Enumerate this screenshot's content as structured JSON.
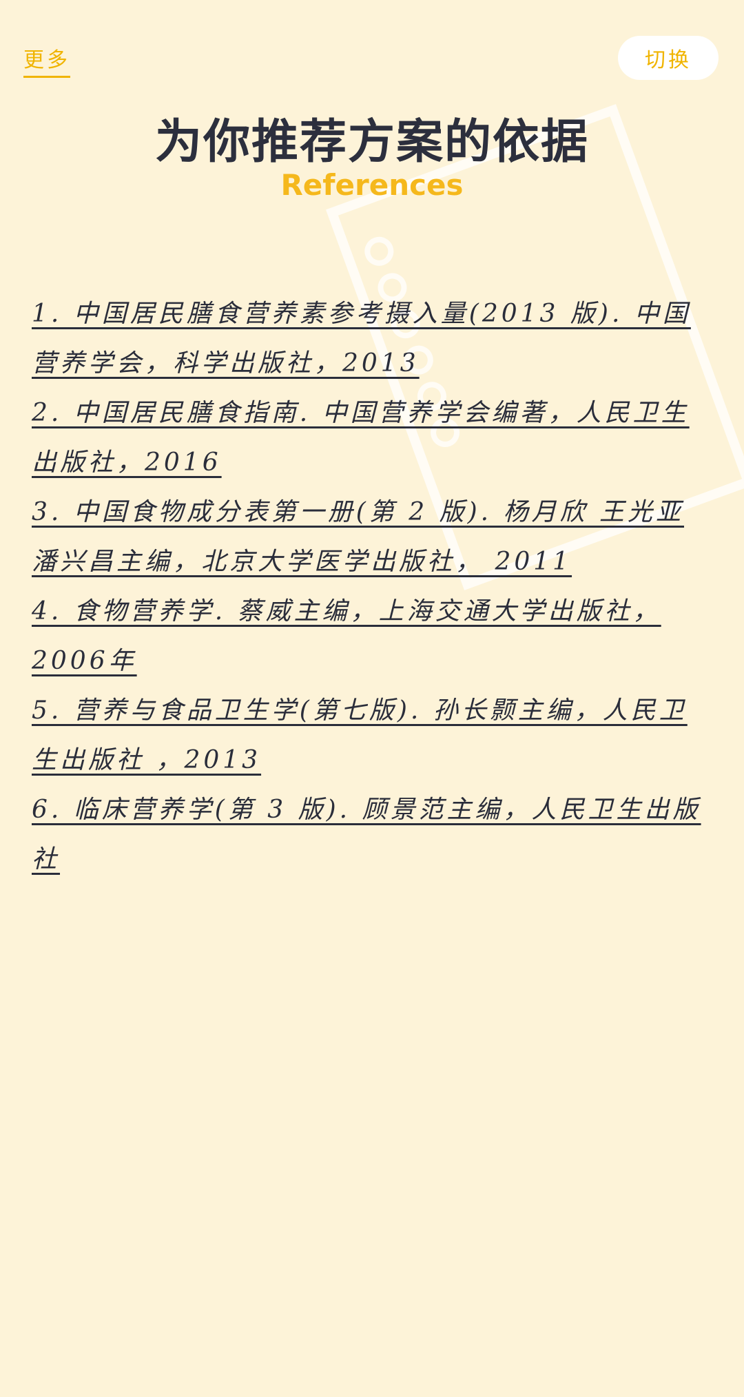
{
  "header": {
    "more_label": "更多",
    "switch_label": "切换"
  },
  "title": "为你推荐方案的依据",
  "subtitle": "References",
  "references": [
    "1. 中国居民膳食营养素参考摄入量(2013 版). 中国营养学会，科学出版社，2013",
    "2. 中国居民膳食指南. 中国营养学会编著，人民卫生出版社，2016",
    "3. 中国食物成分表第一册(第 2 版). 杨月欣 王光亚 潘兴昌主编，北京大学医学出版社， 2011",
    "4. 食物营养学. 蔡威主编，上海交通大学出版社，2006年",
    "5. 营养与食品卫生学(第七版). 孙长颢主编，人民卫生出版社 ，2013",
    "6. 临床营养学(第 3 版). 顾景范主编，人民卫生出版社"
  ],
  "colors": {
    "background": "#fdf3d8",
    "accent": "#f0b400",
    "title": "#2c2f3d",
    "text": "#2a2d3a"
  }
}
